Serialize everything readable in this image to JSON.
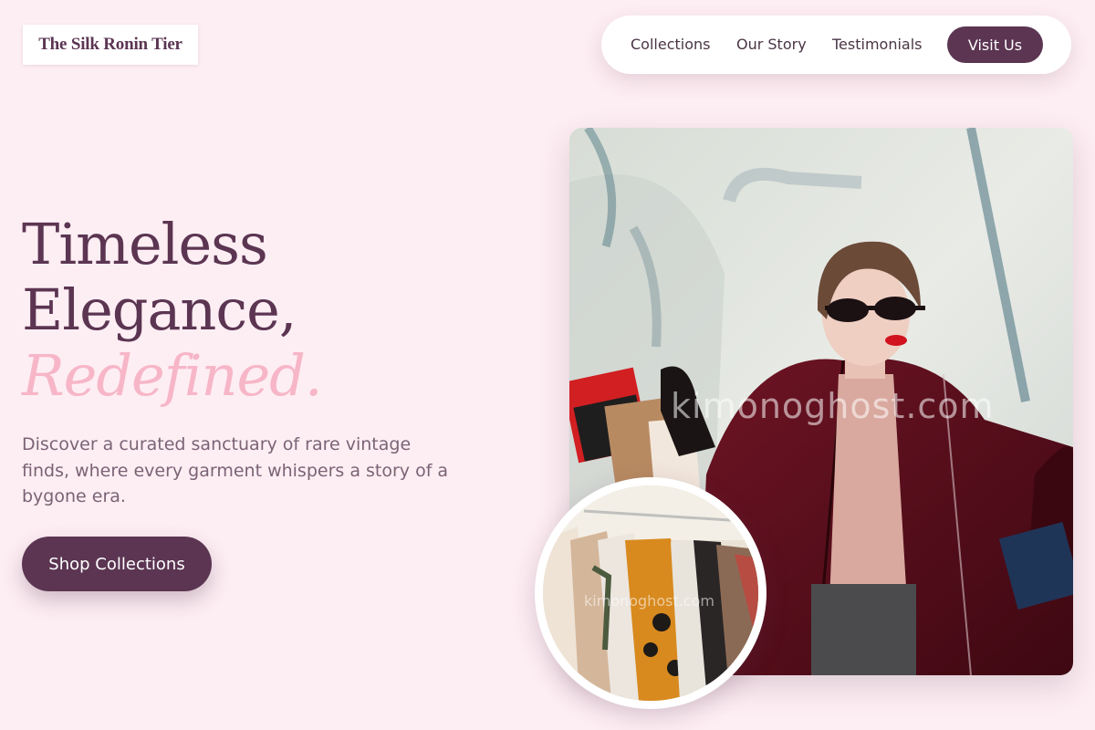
{
  "brand": {
    "logo_text": "The Silk Ronin Tier"
  },
  "nav": {
    "links": [
      "Collections",
      "Our Story",
      "Testimonials"
    ],
    "cta_label": "Visit Us"
  },
  "hero": {
    "title_line1": "Timeless",
    "title_line2": "Elegance,",
    "title_accent": "Redefined.",
    "subtitle": "Discover a curated sanctuary of rare vintage finds, where every garment whispers a story of a bygone era.",
    "cta_label": "Shop Collections"
  },
  "images": {
    "main": {
      "subject": "woman-in-burgundy-coat-with-shopping-bags",
      "watermark": "kimonoghost.com"
    },
    "inset": {
      "subject": "clothing-rack-with-vintage-garments",
      "watermark": "kimonoghost.com"
    }
  },
  "colors": {
    "background": "#fdeef3",
    "primary": "#5b3552",
    "accent": "#f7b6c8",
    "body_text": "#7b6376"
  }
}
